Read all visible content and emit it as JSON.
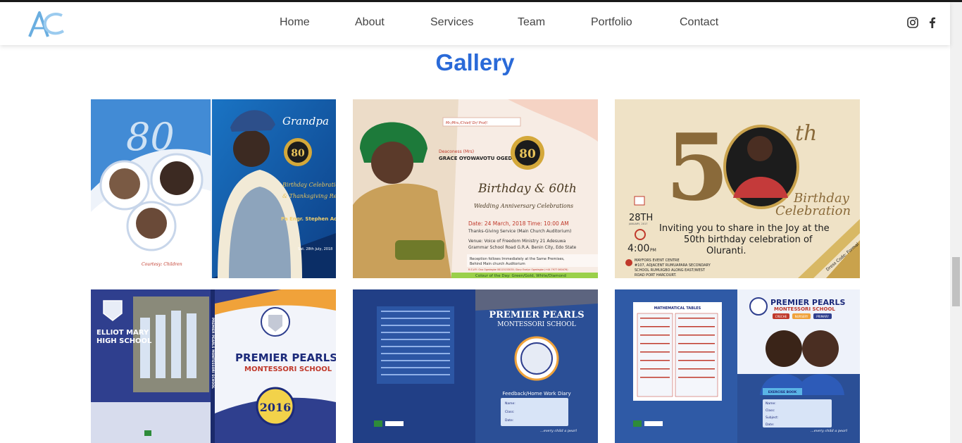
{
  "nav": {
    "items": [
      "Home",
      "About",
      "Services",
      "Team",
      "Portfolio",
      "Contact"
    ]
  },
  "social": [
    "instagram-icon",
    "facebook-icon"
  ],
  "gallery": {
    "title": "Gallery",
    "cards": [
      {
        "name": "grandpa-80th-birthday-card",
        "big_number": "80",
        "heading": "Grandpa",
        "badge": "80",
        "script_lines": [
          "Birthday Celebration",
          "& Thanksgiving Reception"
        ],
        "person": "Pa Engr. Stephen Adegoju Bamgbade",
        "date": "Sat. 28th July, 2018",
        "footer": "Courtesy: Children"
      },
      {
        "name": "grace-80th-birthday-card",
        "to_line": "Mr./Mrs./Chief/ Dr/ Prof/:",
        "badge": "80",
        "honoree_title": "Deaconess (Mrs)",
        "honoree_name": "GRACE OYOWAVOTU OGEDEGBE",
        "headline": "Birthday & 60th",
        "subheadline": "Wedding Anniversary Celebrations",
        "date_line": "Date: 24 March, 2018  Time: 10:00 AM",
        "service_line": "Thanks-Giving Service (Main Church Auditorium)",
        "venue_line1": "Venue: Voice of Freedom Ministry 21 Adesuwa",
        "venue_line2": "Grammar School Road G.R.A. Benin City, Edo State",
        "reception_line1": "Reception follows Immediately at the Same Premises,",
        "reception_line2": "Behind Main church Auditorium",
        "rsvp": "R.S.V.P.: Ona Ogedegbe 08115153035; Glory Evelyn Ogedegbe (+44 7977 060476)",
        "colour_line": "Colour of the Day: Green/Gold, White/Diamond"
      },
      {
        "name": "50th-birthday-card",
        "number": "50",
        "suffix": "th",
        "script_lines": [
          "Birthday",
          "Celebration"
        ],
        "date_day": "28TH",
        "date_rest": "JANUARY, 2017",
        "time": "4:00",
        "time_suffix": "PM",
        "invite_lines": [
          "Inviting  you to share in the Joy at the",
          "50th birthday celebration of",
          "Oluranti."
        ],
        "venue_lines": [
          "MAYFORS EVENT CENTRE",
          "#107, ADJACENT RUMUAPARA SECONDARY",
          "SCHOOL RUMUIGBO ALONG EAST/WEST",
          "ROAD PORT HARCOURT."
        ],
        "dress_code": "Dress Code: Formal"
      },
      {
        "name": "elliot-mary-premier-pearls-card",
        "left_school": [
          "ELLIOT MARY",
          "HIGH SCHOOL"
        ],
        "spine": "PREMIER PEARLS MONTESSORI SCHOOL",
        "right_school": [
          "PREMIER PEARLS",
          "MONTESSORI SCHOOL"
        ],
        "year": "2016"
      },
      {
        "name": "feedback-diary-card",
        "school": [
          "PREMIER PEARLS",
          "MONTESSORI SCHOOL"
        ],
        "title": "Feedback/Home Work Diary",
        "fields": [
          "Name:",
          "Class:",
          "Date:"
        ],
        "motto": "...every child a pearl"
      },
      {
        "name": "exercise-book-card",
        "table_title": "MATHEMATICAL TABLES",
        "school": [
          "PREMIER PEARLS",
          "MONTESSORI SCHOOL"
        ],
        "levels": [
          "CRECHE",
          "NURSERY",
          "PRIMARY"
        ],
        "book_label": "EXERCISE BOOK",
        "fields": [
          "Name:",
          "Class:",
          "Subject:",
          "Date:"
        ],
        "motto": "...every child a pearl"
      }
    ]
  }
}
